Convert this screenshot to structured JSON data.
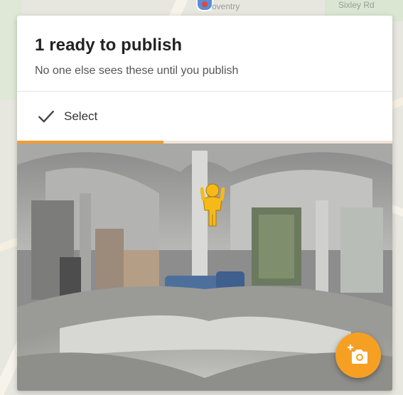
{
  "map": {
    "labels": [
      "oventry",
      "Sixley Rd"
    ]
  },
  "card": {
    "title": "1 ready to publish",
    "subtitle": "No one else sees these until you publish",
    "select_label": "Select"
  },
  "upload": {
    "progress_fraction": 0.39
  },
  "colors": {
    "accent": "#f39c34",
    "fab": "#f6a023",
    "pegman": "#f5b91a"
  },
  "icons": {
    "select": "checkmark-icon",
    "fab": "add-photo-camera-icon",
    "pegman": "pegman-icon"
  }
}
